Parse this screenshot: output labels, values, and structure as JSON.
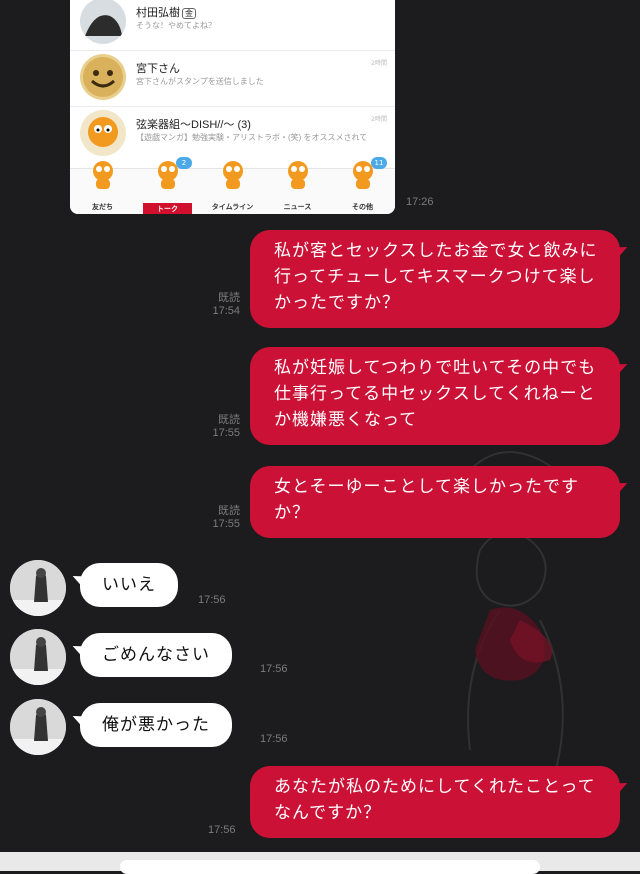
{
  "screenshot": {
    "chats": [
      {
        "name": "村田弘樹",
        "badge": "金",
        "preview": "そうな！やめてよね？",
        "time": ""
      },
      {
        "name": "宮下さん",
        "preview": "宮下さんがスタンプを送信しました",
        "time": "2時間"
      },
      {
        "name": "弦楽器組〜DISH//〜 (3)",
        "preview": "【遊戯マンガ】勉強実験・アリストラボ・(笑) をオススメされて…",
        "time": "2時間"
      }
    ],
    "tabs": [
      {
        "label": "友だち",
        "badge": "",
        "active": false
      },
      {
        "label": "トーク",
        "badge": "2",
        "active": true
      },
      {
        "label": "タイムライン",
        "badge": "",
        "active": false
      },
      {
        "label": "ニュース",
        "badge": "",
        "active": false
      },
      {
        "label": "その他",
        "badge": "11",
        "active": false
      }
    ]
  },
  "messages": {
    "m0": {
      "time": "17:26"
    },
    "m1": {
      "text": "私が客とセックスしたお金で女と飲みに行ってチューしてキスマークつけて楽しかったですか？",
      "read": "既読",
      "time": "17:54"
    },
    "m2": {
      "text": "私が妊娠してつわりで吐いてその中でも仕事行ってる中セックスしてくれねーとか機嫌悪くなって",
      "read": "既読",
      "time": "17:55"
    },
    "m3": {
      "text": "女とそーゆーことして楽しかったですか？",
      "read": "既読",
      "time": "17:55"
    },
    "m4": {
      "text": "いいえ",
      "time": "17:56"
    },
    "m5": {
      "text": "ごめんなさい",
      "time": "17:56"
    },
    "m6": {
      "text": "俺が悪かった",
      "time": "17:56"
    },
    "m7": {
      "text": "あなたが私のためにしてくれたことってなんですか？",
      "time": "17:56"
    }
  },
  "colors": {
    "background": "#1c1b1d",
    "outgoing_bubble": "#cc1137",
    "incoming_bubble": "#ffffff",
    "timestamp": "#7c7c7c"
  }
}
